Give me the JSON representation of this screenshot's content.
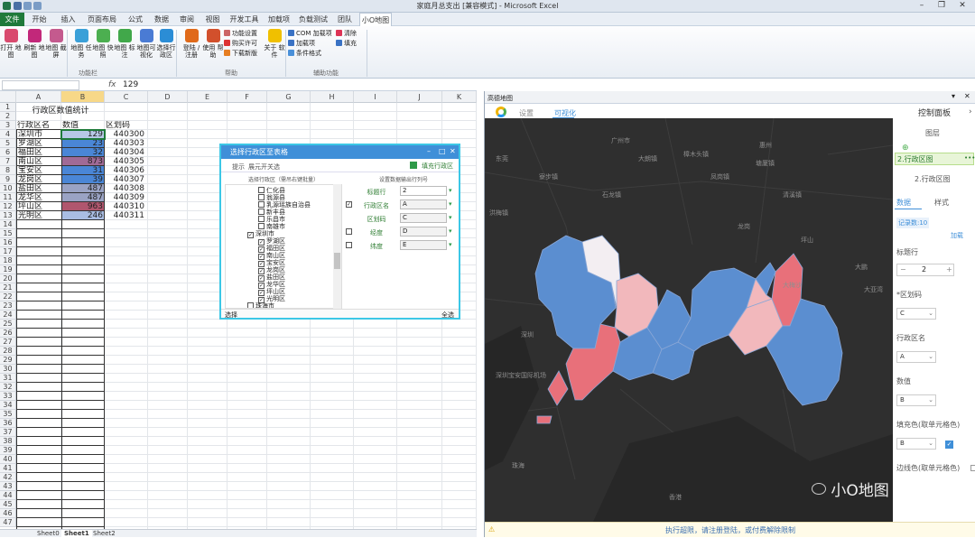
{
  "window_title": "家庭月总支出 [兼容模式] - Microsoft Excel",
  "ribbon_tabs": [
    "文件",
    "开始",
    "插入",
    "页面布局",
    "公式",
    "数据",
    "审阅",
    "视图",
    "开发工具",
    "加载项",
    "负载测试",
    "团队",
    "小O地图"
  ],
  "active_tab": "小O地图",
  "ribbon": {
    "buttons": [
      {
        "label": "打开 地图",
        "color": "#d94a6e"
      },
      {
        "label": "刷新 地图",
        "color": "#c2287a"
      },
      {
        "label": "地图 截屏",
        "color": "#c45a8e"
      },
      {
        "label": "地图 任务",
        "color": "#3aa0d8"
      },
      {
        "label": "地图 快照",
        "color": "#4caf50"
      },
      {
        "label": "地图 标注",
        "color": "#41a84a"
      },
      {
        "label": "地图可 视化",
        "color": "#4a7bd4"
      },
      {
        "label": "选择行 政区",
        "color": "#2b8dd6"
      },
      {
        "label": "登陆 /注册",
        "color": "#e06a1a"
      },
      {
        "label": "使用 帮助",
        "color": "#d2502c"
      },
      {
        "label": "关于 软件",
        "color": "#f0c000"
      }
    ],
    "small_buttons": [
      {
        "label": "功能设置",
        "color": "#c66"
      },
      {
        "label": "购买许可",
        "color": "#d33"
      },
      {
        "label": "下载新版",
        "color": "#e67e22"
      },
      {
        "label": "COM 加载项",
        "color": "#3a72c4"
      },
      {
        "label": "加载项",
        "color": "#3a72c4"
      },
      {
        "label": "条件格式",
        "color": "#4a90d9"
      },
      {
        "label": "清除",
        "color": "#d35"
      },
      {
        "label": "填充",
        "color": "#3a72c4"
      }
    ],
    "groups": [
      "功能栏",
      "帮助",
      "辅助功能"
    ]
  },
  "formula_bar": {
    "fx": "fx",
    "value": "129"
  },
  "columns": [
    "A",
    "B",
    "C",
    "D",
    "E",
    "F",
    "G",
    "H",
    "I",
    "J",
    "K"
  ],
  "spreadsheet": {
    "title": "行政区数值统计",
    "headers": [
      "行政区名",
      "数值",
      "区划码"
    ],
    "rows": [
      {
        "name": "深圳市",
        "value": "129",
        "code": "440300",
        "fill": "#b7c8e6"
      },
      {
        "name": "罗湖区",
        "value": "23",
        "code": "440303",
        "fill": "#4a86d6"
      },
      {
        "name": "福田区",
        "value": "32",
        "code": "440304",
        "fill": "#4a86d6"
      },
      {
        "name": "南山区",
        "value": "873",
        "code": "440305",
        "fill": "#a06a96"
      },
      {
        "name": "宝安区",
        "value": "31",
        "code": "440306",
        "fill": "#4a86d6"
      },
      {
        "name": "龙岗区",
        "value": "39",
        "code": "440307",
        "fill": "#4a86d6"
      },
      {
        "name": "盐田区",
        "value": "487",
        "code": "440308",
        "fill": "#9aa3c4"
      },
      {
        "name": "龙华区",
        "value": "487",
        "code": "440309",
        "fill": "#9aa3c4"
      },
      {
        "name": "坪山区",
        "value": "963",
        "code": "440310",
        "fill": "#b0566e"
      },
      {
        "name": "光明区",
        "value": "246",
        "code": "440311",
        "fill": "#a9bde3"
      }
    ],
    "row_numbers": [
      "1",
      "2",
      "3",
      "4",
      "5",
      "6",
      "7",
      "8",
      "9",
      "10",
      "11",
      "12",
      "13",
      "14",
      "15",
      "16",
      "17",
      "18",
      "19",
      "20",
      "21",
      "22",
      "23",
      "24",
      "25",
      "26",
      "27",
      "28",
      "29",
      "30",
      "31",
      "32",
      "33",
      "34",
      "35",
      "36",
      "37",
      "38",
      "39",
      "40",
      "41",
      "42",
      "43",
      "44",
      "45",
      "46",
      "47"
    ]
  },
  "sheet_tabs": [
    "Sheet0",
    "Sheet1",
    "Sheet2"
  ],
  "dialog": {
    "title": "选择行政区至表格",
    "toolbar": [
      "提示",
      "展元开关选"
    ],
    "fill_button": "填充行政区",
    "left_header": "选择行政区（需吊右键批量）",
    "right_header": "设置数据输出行列号",
    "tree": [
      {
        "label": "仁化县",
        "checked": false,
        "indent": 3
      },
      {
        "label": "翁源县",
        "checked": false,
        "indent": 3
      },
      {
        "label": "乳源瑶族自治县",
        "checked": false,
        "indent": 3
      },
      {
        "label": "新丰县",
        "checked": false,
        "indent": 3
      },
      {
        "label": "乐昌市",
        "checked": false,
        "indent": 3
      },
      {
        "label": "南雄市",
        "checked": false,
        "indent": 3
      },
      {
        "label": "深圳市",
        "checked": true,
        "indent": 2
      },
      {
        "label": "罗湖区",
        "checked": true,
        "indent": 3
      },
      {
        "label": "福田区",
        "checked": true,
        "indent": 3
      },
      {
        "label": "南山区",
        "checked": true,
        "indent": 3
      },
      {
        "label": "宝安区",
        "checked": true,
        "indent": 3
      },
      {
        "label": "龙岗区",
        "checked": true,
        "indent": 3
      },
      {
        "label": "盐田区",
        "checked": true,
        "indent": 3
      },
      {
        "label": "龙华区",
        "checked": true,
        "indent": 3
      },
      {
        "label": "坪山区",
        "checked": true,
        "indent": 3
      },
      {
        "label": "光明区",
        "checked": true,
        "indent": 3
      },
      {
        "label": "珠海市",
        "checked": false,
        "indent": 2
      },
      {
        "label": "汕头市",
        "checked": false,
        "indent": 2
      }
    ],
    "fields": [
      {
        "label": "标题行",
        "value": "2",
        "checked": null
      },
      {
        "label": "行政区名",
        "value": "A",
        "checked": true
      },
      {
        "label": "区划码",
        "value": "C",
        "checked": null
      },
      {
        "label": "经度",
        "value": "D",
        "checked": false
      },
      {
        "label": "纬度",
        "value": "E",
        "checked": false
      }
    ],
    "footer_left": "选择",
    "footer_right": "全选"
  },
  "map_pane": {
    "title": "高德地图",
    "tabs": [
      "设置",
      "可视化"
    ],
    "bottom_message": "执行超限，请注册登陆，或付费解除限制",
    "watermark": "小O地图",
    "map_labels": [
      "东莞",
      "深圳",
      "香港",
      "惠州",
      "大亚湾",
      "清溪镇",
      "凤岗镇",
      "龙岗",
      "坪山",
      "大鹏",
      "大梅沙",
      "珠海",
      "广州市",
      "深圳宝安国际机场",
      "塘厦镇",
      "樟木头镇",
      "石龙镇",
      "寮步镇",
      "洪梅镇",
      "大朗镇"
    ]
  },
  "control_panel": {
    "title": "控制面板",
    "layer_label": "图层",
    "layer_name": "2.行政区图",
    "subtitle": "2.行政区图",
    "tabs": [
      "数据",
      "样式"
    ],
    "record_count": "记录数:10",
    "load": "加载",
    "title_row_label": "标题行",
    "title_row_value": "2",
    "fields": [
      {
        "label": "*区划码",
        "value": "C"
      },
      {
        "label": "行政区名",
        "value": "A"
      },
      {
        "label": "数值",
        "value": "B"
      },
      {
        "label": "填充色(取单元格色)",
        "value": "B"
      },
      {
        "label": "边线色(取单元格色)",
        "value": ""
      }
    ]
  },
  "colors": {
    "accent": "#3f8fd8",
    "map_bg": "#2f2f2f",
    "blue": "#5b8ed0",
    "red": "#e8707a",
    "pink": "#f2b8bc",
    "light": "#f3eef2"
  }
}
